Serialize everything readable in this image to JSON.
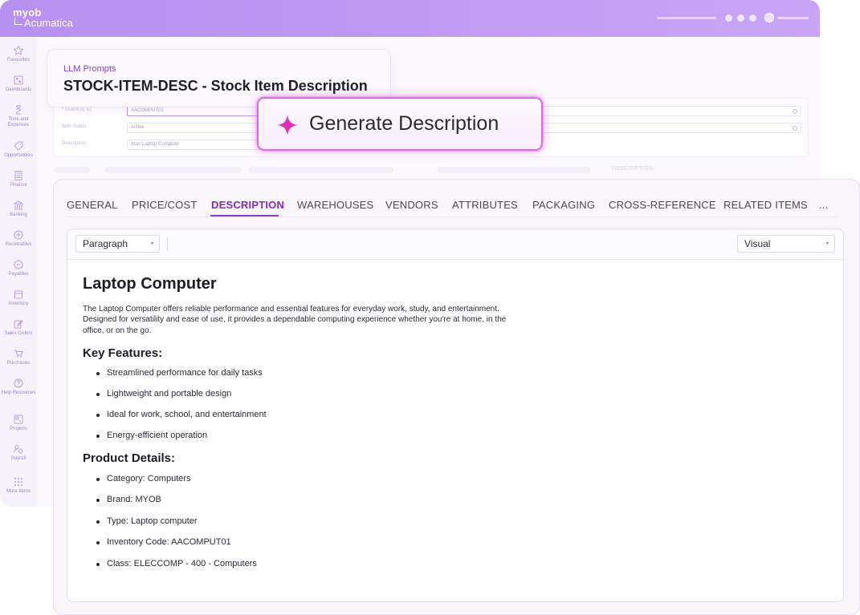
{
  "app": {
    "logo_line1": "myob",
    "logo_line2": "Acumatica"
  },
  "sidebar": {
    "items": [
      {
        "label": "Favourites",
        "icon": "star-icon"
      },
      {
        "label": "Dashboards",
        "icon": "dashboard-icon"
      },
      {
        "label": "Time and Expenses",
        "icon": "hourglass-icon"
      },
      {
        "label": "Opportunities",
        "icon": "tag-icon"
      },
      {
        "label": "Finance",
        "icon": "calculator-icon"
      },
      {
        "label": "Banking",
        "icon": "bank-icon"
      },
      {
        "label": "Receivables",
        "icon": "plus-circle-icon"
      },
      {
        "label": "Payables",
        "icon": "minus-circle-icon"
      },
      {
        "label": "Inventory",
        "icon": "box-icon"
      },
      {
        "label": "Sales Orders",
        "icon": "edit-icon"
      },
      {
        "label": "Purchases",
        "icon": "cart-icon"
      },
      {
        "label": "Help Resources",
        "icon": "help-icon"
      },
      {
        "label": "Projects",
        "icon": "projects-icon"
      },
      {
        "label": "Payroll",
        "icon": "payroll-icon"
      },
      {
        "label": "More Items",
        "icon": "grid-icon"
      }
    ]
  },
  "background_form": {
    "inventory_id_label": "* Inventory ID:",
    "inventory_id_value": "AACOMPUT01",
    "item_status_label": "Item Status:",
    "item_status_value": "Active",
    "description_label": "Description:",
    "description_value": "Acer Laptop Computer",
    "ghost_active_tab": "DESCRIPTION"
  },
  "prompt_card": {
    "eyebrow": "LLM Prompts",
    "title": "STOCK-ITEM-DESC - Stock Item Description"
  },
  "generate_button": {
    "label": "Generate Description"
  },
  "tabs": [
    {
      "label": "GENERAL"
    },
    {
      "label": "PRICE/COST"
    },
    {
      "label": "DESCRIPTION"
    },
    {
      "label": "WAREHOUSES"
    },
    {
      "label": "VENDORS"
    },
    {
      "label": "ATTRIBUTES"
    },
    {
      "label": "PACKAGING"
    },
    {
      "label": "CROSS-REFERENCE"
    },
    {
      "label": "RELATED ITEMS"
    },
    {
      "label": "..."
    }
  ],
  "toolbar": {
    "format_select": "Paragraph",
    "view_select": "Visual"
  },
  "document": {
    "title": "Laptop Computer",
    "intro": "The Laptop Computer offers reliable performance and essential features for everyday work, study, and entertainment. Designed for versatility and ease of use, it provides a dependable computing experience whether you're at home, in the office, or on the go.",
    "features_heading": "Key Features:",
    "features": [
      "Streamlined performance for daily tasks",
      "Lightweight and portable design",
      "Ideal for work, school, and entertainment",
      "Energy-efficient operation"
    ],
    "details_heading": "Product Details:",
    "details": [
      "Category: Computers",
      "Brand: MYOB",
      "Type: Laptop computer",
      "Inventory Code: AACOMPUT01",
      "Class: ELECCOMP - 400 - Computers"
    ]
  },
  "colors": {
    "accent": "#7a2cc4",
    "topbar": "#c09cf3",
    "generate_border": "#d76ce5"
  }
}
